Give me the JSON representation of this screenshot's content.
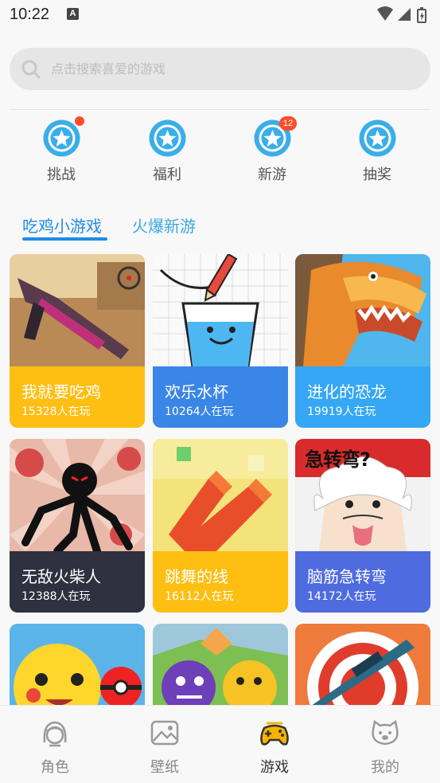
{
  "status_bar": {
    "time": "10:22",
    "notification_icon": "A"
  },
  "search": {
    "placeholder": "点击搜索喜爱的游戏"
  },
  "quick_actions": [
    {
      "label": "挑战",
      "icon": "star-badge-icon",
      "has_dot": true
    },
    {
      "label": "福利",
      "icon": "star-badge-icon"
    },
    {
      "label": "新游",
      "icon": "star-badge-icon",
      "badge": "12"
    },
    {
      "label": "抽奖",
      "icon": "star-badge-icon"
    }
  ],
  "tabs": [
    {
      "label": "吃鸡小游戏",
      "active": true
    },
    {
      "label": "火爆新游",
      "active": false
    }
  ],
  "games": [
    {
      "title": "我就要吃鸡",
      "players": "15328人在玩"
    },
    {
      "title": "欢乐水杯",
      "players": "10264人在玩"
    },
    {
      "title": "进化的恐龙",
      "players": "19919人在玩"
    },
    {
      "title": "无敌火柴人",
      "players": "12388人在玩"
    },
    {
      "title": "跳舞的线",
      "players": "16112人在玩"
    },
    {
      "title": "脑筋急转弯",
      "players": "14172人在玩",
      "art_text": "急转弯?"
    }
  ],
  "bottom_nav": [
    {
      "label": "角色",
      "icon": "character-icon"
    },
    {
      "label": "壁纸",
      "icon": "wallpaper-icon"
    },
    {
      "label": "游戏",
      "icon": "gamepad-icon",
      "active": true
    },
    {
      "label": "我的",
      "icon": "profile-icon"
    }
  ],
  "colors": {
    "accent": "#1e8be8",
    "icon_blue": "#39aee9",
    "badge_red": "#ff4d27",
    "card_yellow": "#ffbe12",
    "card_blue": "#3a86e6",
    "card_sky": "#35a7f5",
    "card_dark": "#2f3140",
    "card_purple": "#4f6be0"
  }
}
